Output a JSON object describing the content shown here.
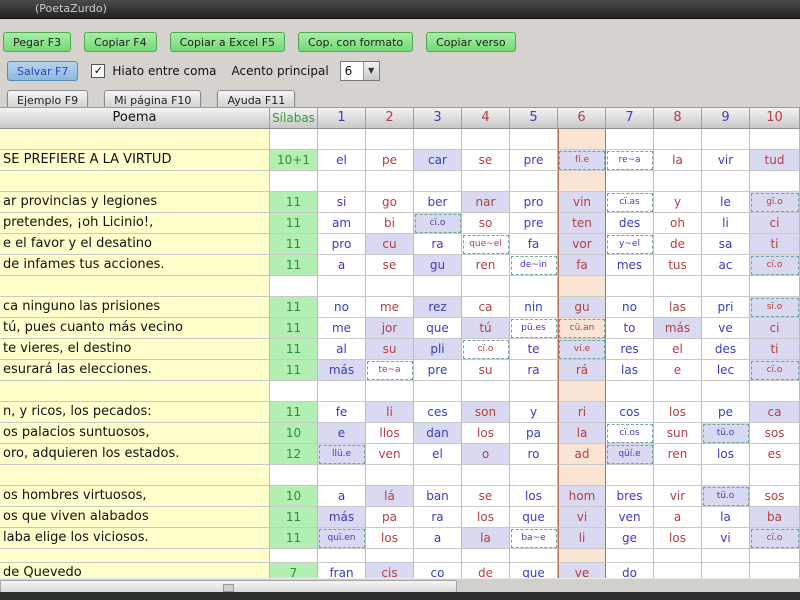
{
  "window": {
    "title": "(PoetaZurdo)"
  },
  "toolbar": {
    "buttons_row1": [
      {
        "label": "Pegar F3"
      },
      {
        "label": "Copiar F4"
      },
      {
        "label": "Copiar a Excel F5"
      },
      {
        "label": "Cop. con formato"
      },
      {
        "label": "Copiar verso"
      }
    ],
    "save_label": "Salvar F7",
    "hiato_label": "Hiato entre coma",
    "hiato_checked": true,
    "check_glyph": "✓",
    "acento_label": "Acento principal",
    "acento_value": "6",
    "buttons_row3": [
      {
        "label": "Ejemplo F9"
      },
      {
        "label": "Mi página F10"
      },
      {
        "label": "Ayuda F11"
      }
    ]
  },
  "colors": {
    "green_button": "#8fe18f",
    "blue_button": "#a0c4e4",
    "poem_bg": "#ffffcc",
    "silabas_bg": "#b3efb3",
    "stressed_bg": "#d9d9f2",
    "accent_column_bg": "#fae4d3",
    "accent_column_border": "#bb6a55",
    "blue_text": "#3c3cbe",
    "red_text": "#b24040",
    "green_text": "#2c8f3c"
  },
  "table": {
    "poem_header": "Poema",
    "silabas_header": "Sílabas",
    "column_numbers": [
      "1",
      "2",
      "3",
      "4",
      "5",
      "6",
      "7",
      "8",
      "9",
      "10"
    ],
    "accent_column": 6,
    "rows": [
      {
        "spacer": true
      },
      {
        "poem": "SE PREFIERE A LA VIRTUD",
        "silabas": "10+1",
        "cells": [
          {
            "t": "el"
          },
          {
            "t": "pe"
          },
          {
            "t": "car",
            "s": 1
          },
          {
            "t": "se"
          },
          {
            "t": "pre"
          },
          {
            "t": "fí.e",
            "s": 1,
            "d": 1
          },
          {
            "t": "re~a",
            "d": 1
          },
          {
            "t": "la"
          },
          {
            "t": "vir"
          },
          {
            "t": "tud",
            "s": 1
          }
        ]
      },
      {
        "spacer": true
      },
      {
        "poem": "ar provincias y legiones",
        "silabas": "11",
        "cells": [
          {
            "t": "si"
          },
          {
            "t": "go"
          },
          {
            "t": "ber"
          },
          {
            "t": "nar",
            "s": 1
          },
          {
            "t": "pro"
          },
          {
            "t": "vin",
            "s": 1
          },
          {
            "t": "cï.as",
            "d": 1
          },
          {
            "t": "y"
          },
          {
            "t": "le"
          },
          {
            "t": "gï.o",
            "s": 1,
            "d": 1
          }
        ]
      },
      {
        "poem": "pretendes, ¡oh Licinio!,",
        "silabas": "11",
        "cells": [
          {
            "t": "am"
          },
          {
            "t": "bi"
          },
          {
            "t": "cï.o",
            "s": 1,
            "d": 1
          },
          {
            "t": "so"
          },
          {
            "t": "pre"
          },
          {
            "t": "ten",
            "s": 1
          },
          {
            "t": "des"
          },
          {
            "t": "oh"
          },
          {
            "t": "li"
          },
          {
            "t": "ci",
            "s": 1
          }
        ]
      },
      {
        "poem": "e el favor y el desatino",
        "silabas": "11",
        "cells": [
          {
            "t": "pro"
          },
          {
            "t": "cu",
            "s": 1
          },
          {
            "t": "ra"
          },
          {
            "t": "que~el",
            "d": 1
          },
          {
            "t": "fa"
          },
          {
            "t": "vor",
            "s": 1
          },
          {
            "t": "y~el",
            "d": 1
          },
          {
            "t": "de"
          },
          {
            "t": "sa"
          },
          {
            "t": "ti",
            "s": 1
          }
        ]
      },
      {
        "poem": "de infames tus acciones.",
        "silabas": "11",
        "cells": [
          {
            "t": "a"
          },
          {
            "t": "se"
          },
          {
            "t": "gu",
            "s": 1
          },
          {
            "t": "ren"
          },
          {
            "t": "de~in",
            "d": 1
          },
          {
            "t": "fa",
            "s": 1
          },
          {
            "t": "mes"
          },
          {
            "t": "tus"
          },
          {
            "t": "ac"
          },
          {
            "t": "cï.o",
            "s": 1,
            "d": 1
          }
        ]
      },
      {
        "spacer": true
      },
      {
        "poem": "ca ninguno las prisiones",
        "silabas": "11",
        "cells": [
          {
            "t": "no"
          },
          {
            "t": "me"
          },
          {
            "t": "rez",
            "s": 1
          },
          {
            "t": "ca"
          },
          {
            "t": "nin"
          },
          {
            "t": "gu",
            "s": 1
          },
          {
            "t": "no"
          },
          {
            "t": "las"
          },
          {
            "t": "pri"
          },
          {
            "t": "sï.o",
            "s": 1,
            "d": 1
          }
        ]
      },
      {
        "poem": "tú, pues cuanto más vecino",
        "silabas": "11",
        "cells": [
          {
            "t": "me"
          },
          {
            "t": "jor",
            "s": 1
          },
          {
            "t": "que"
          },
          {
            "t": "tú",
            "s": 1
          },
          {
            "t": "pü.es",
            "d": 1
          },
          {
            "t": "cü.an",
            "d": 1
          },
          {
            "t": "to"
          },
          {
            "t": "más",
            "s": 1
          },
          {
            "t": "ve"
          },
          {
            "t": "ci",
            "s": 1
          }
        ]
      },
      {
        "poem": "te vieres, el destino",
        "silabas": "11",
        "cells": [
          {
            "t": "al"
          },
          {
            "t": "su",
            "s": 1
          },
          {
            "t": "pli",
            "s": 1
          },
          {
            "t": "cï.o",
            "d": 1
          },
          {
            "t": "te"
          },
          {
            "t": "ví.e",
            "s": 1,
            "d": 1
          },
          {
            "t": "res"
          },
          {
            "t": "el"
          },
          {
            "t": "des"
          },
          {
            "t": "ti",
            "s": 1
          }
        ]
      },
      {
        "poem": "esurará las elecciones.",
        "silabas": "11",
        "cells": [
          {
            "t": "más",
            "s": 1
          },
          {
            "t": "te~a",
            "d": 1
          },
          {
            "t": "pre"
          },
          {
            "t": "su"
          },
          {
            "t": "ra"
          },
          {
            "t": "rá",
            "s": 1
          },
          {
            "t": "las"
          },
          {
            "t": "e"
          },
          {
            "t": "lec"
          },
          {
            "t": "cï.o",
            "s": 1,
            "d": 1
          }
        ]
      },
      {
        "spacer": true
      },
      {
        "poem": "n, y ricos, los pecados:",
        "silabas": "11",
        "cells": [
          {
            "t": "fe"
          },
          {
            "t": "li",
            "s": 1
          },
          {
            "t": "ces"
          },
          {
            "t": "son",
            "s": 1
          },
          {
            "t": "y"
          },
          {
            "t": "ri",
            "s": 1
          },
          {
            "t": "cos"
          },
          {
            "t": "los"
          },
          {
            "t": "pe"
          },
          {
            "t": "ca",
            "s": 1
          }
        ]
      },
      {
        "poem": "os palacios suntuosos,",
        "silabas": "10",
        "cells": [
          {
            "t": "e",
            "s": 1
          },
          {
            "t": "llos"
          },
          {
            "t": "dan",
            "s": 1
          },
          {
            "t": "los"
          },
          {
            "t": "pa"
          },
          {
            "t": "la",
            "s": 1
          },
          {
            "t": "cï.os",
            "d": 1
          },
          {
            "t": "sun"
          },
          {
            "t": "tü.o",
            "s": 1,
            "d": 1
          },
          {
            "t": "sos"
          }
        ]
      },
      {
        "poem": "oro, adquieren los estados.",
        "silabas": "12",
        "cells": [
          {
            "t": "llü.e",
            "s": 1,
            "d": 1
          },
          {
            "t": "ven"
          },
          {
            "t": "el"
          },
          {
            "t": "o",
            "s": 1
          },
          {
            "t": "ro"
          },
          {
            "t": "ad"
          },
          {
            "t": "qüí.e",
            "s": 1,
            "d": 1
          },
          {
            "t": "ren"
          },
          {
            "t": "los"
          },
          {
            "t": "es"
          }
        ]
      },
      {
        "spacer": true
      },
      {
        "poem": "os hombres virtuosos,",
        "silabas": "10",
        "cells": [
          {
            "t": "a"
          },
          {
            "t": "lá",
            "s": 1
          },
          {
            "t": "ban"
          },
          {
            "t": "se"
          },
          {
            "t": "los"
          },
          {
            "t": "hom",
            "s": 1
          },
          {
            "t": "bres"
          },
          {
            "t": "vir"
          },
          {
            "t": "tü.o",
            "s": 1,
            "d": 1
          },
          {
            "t": "sos"
          }
        ]
      },
      {
        "poem": "os que viven alabados",
        "silabas": "11",
        "cells": [
          {
            "t": "más",
            "s": 1
          },
          {
            "t": "pa"
          },
          {
            "t": "ra"
          },
          {
            "t": "los"
          },
          {
            "t": "que"
          },
          {
            "t": "vi",
            "s": 1
          },
          {
            "t": "ven"
          },
          {
            "t": "a"
          },
          {
            "t": "la"
          },
          {
            "t": "ba",
            "s": 1
          }
        ]
      },
      {
        "poem": "laba elige los viciosos.",
        "silabas": "11",
        "cells": [
          {
            "t": "quï.en",
            "s": 1,
            "d": 1
          },
          {
            "t": "los"
          },
          {
            "t": "a"
          },
          {
            "t": "la",
            "s": 1
          },
          {
            "t": "ba~e",
            "d": 1
          },
          {
            "t": "li",
            "s": 1
          },
          {
            "t": "ge"
          },
          {
            "t": "los"
          },
          {
            "t": "vi"
          },
          {
            "t": "cï.o",
            "s": 1,
            "d": 1
          }
        ]
      },
      {
        "spacer": true,
        "short": true
      },
      {
        "poem": "de Quevedo",
        "silabas": "7",
        "cells": [
          {
            "t": "fran"
          },
          {
            "t": "cis",
            "s": 1
          },
          {
            "t": "co"
          },
          {
            "t": "de"
          },
          {
            "t": "que"
          },
          {
            "t": "ve",
            "s": 1
          },
          {
            "t": "do"
          },
          {
            "t": ""
          },
          {
            "t": ""
          },
          {
            "t": ""
          }
        ]
      }
    ]
  }
}
